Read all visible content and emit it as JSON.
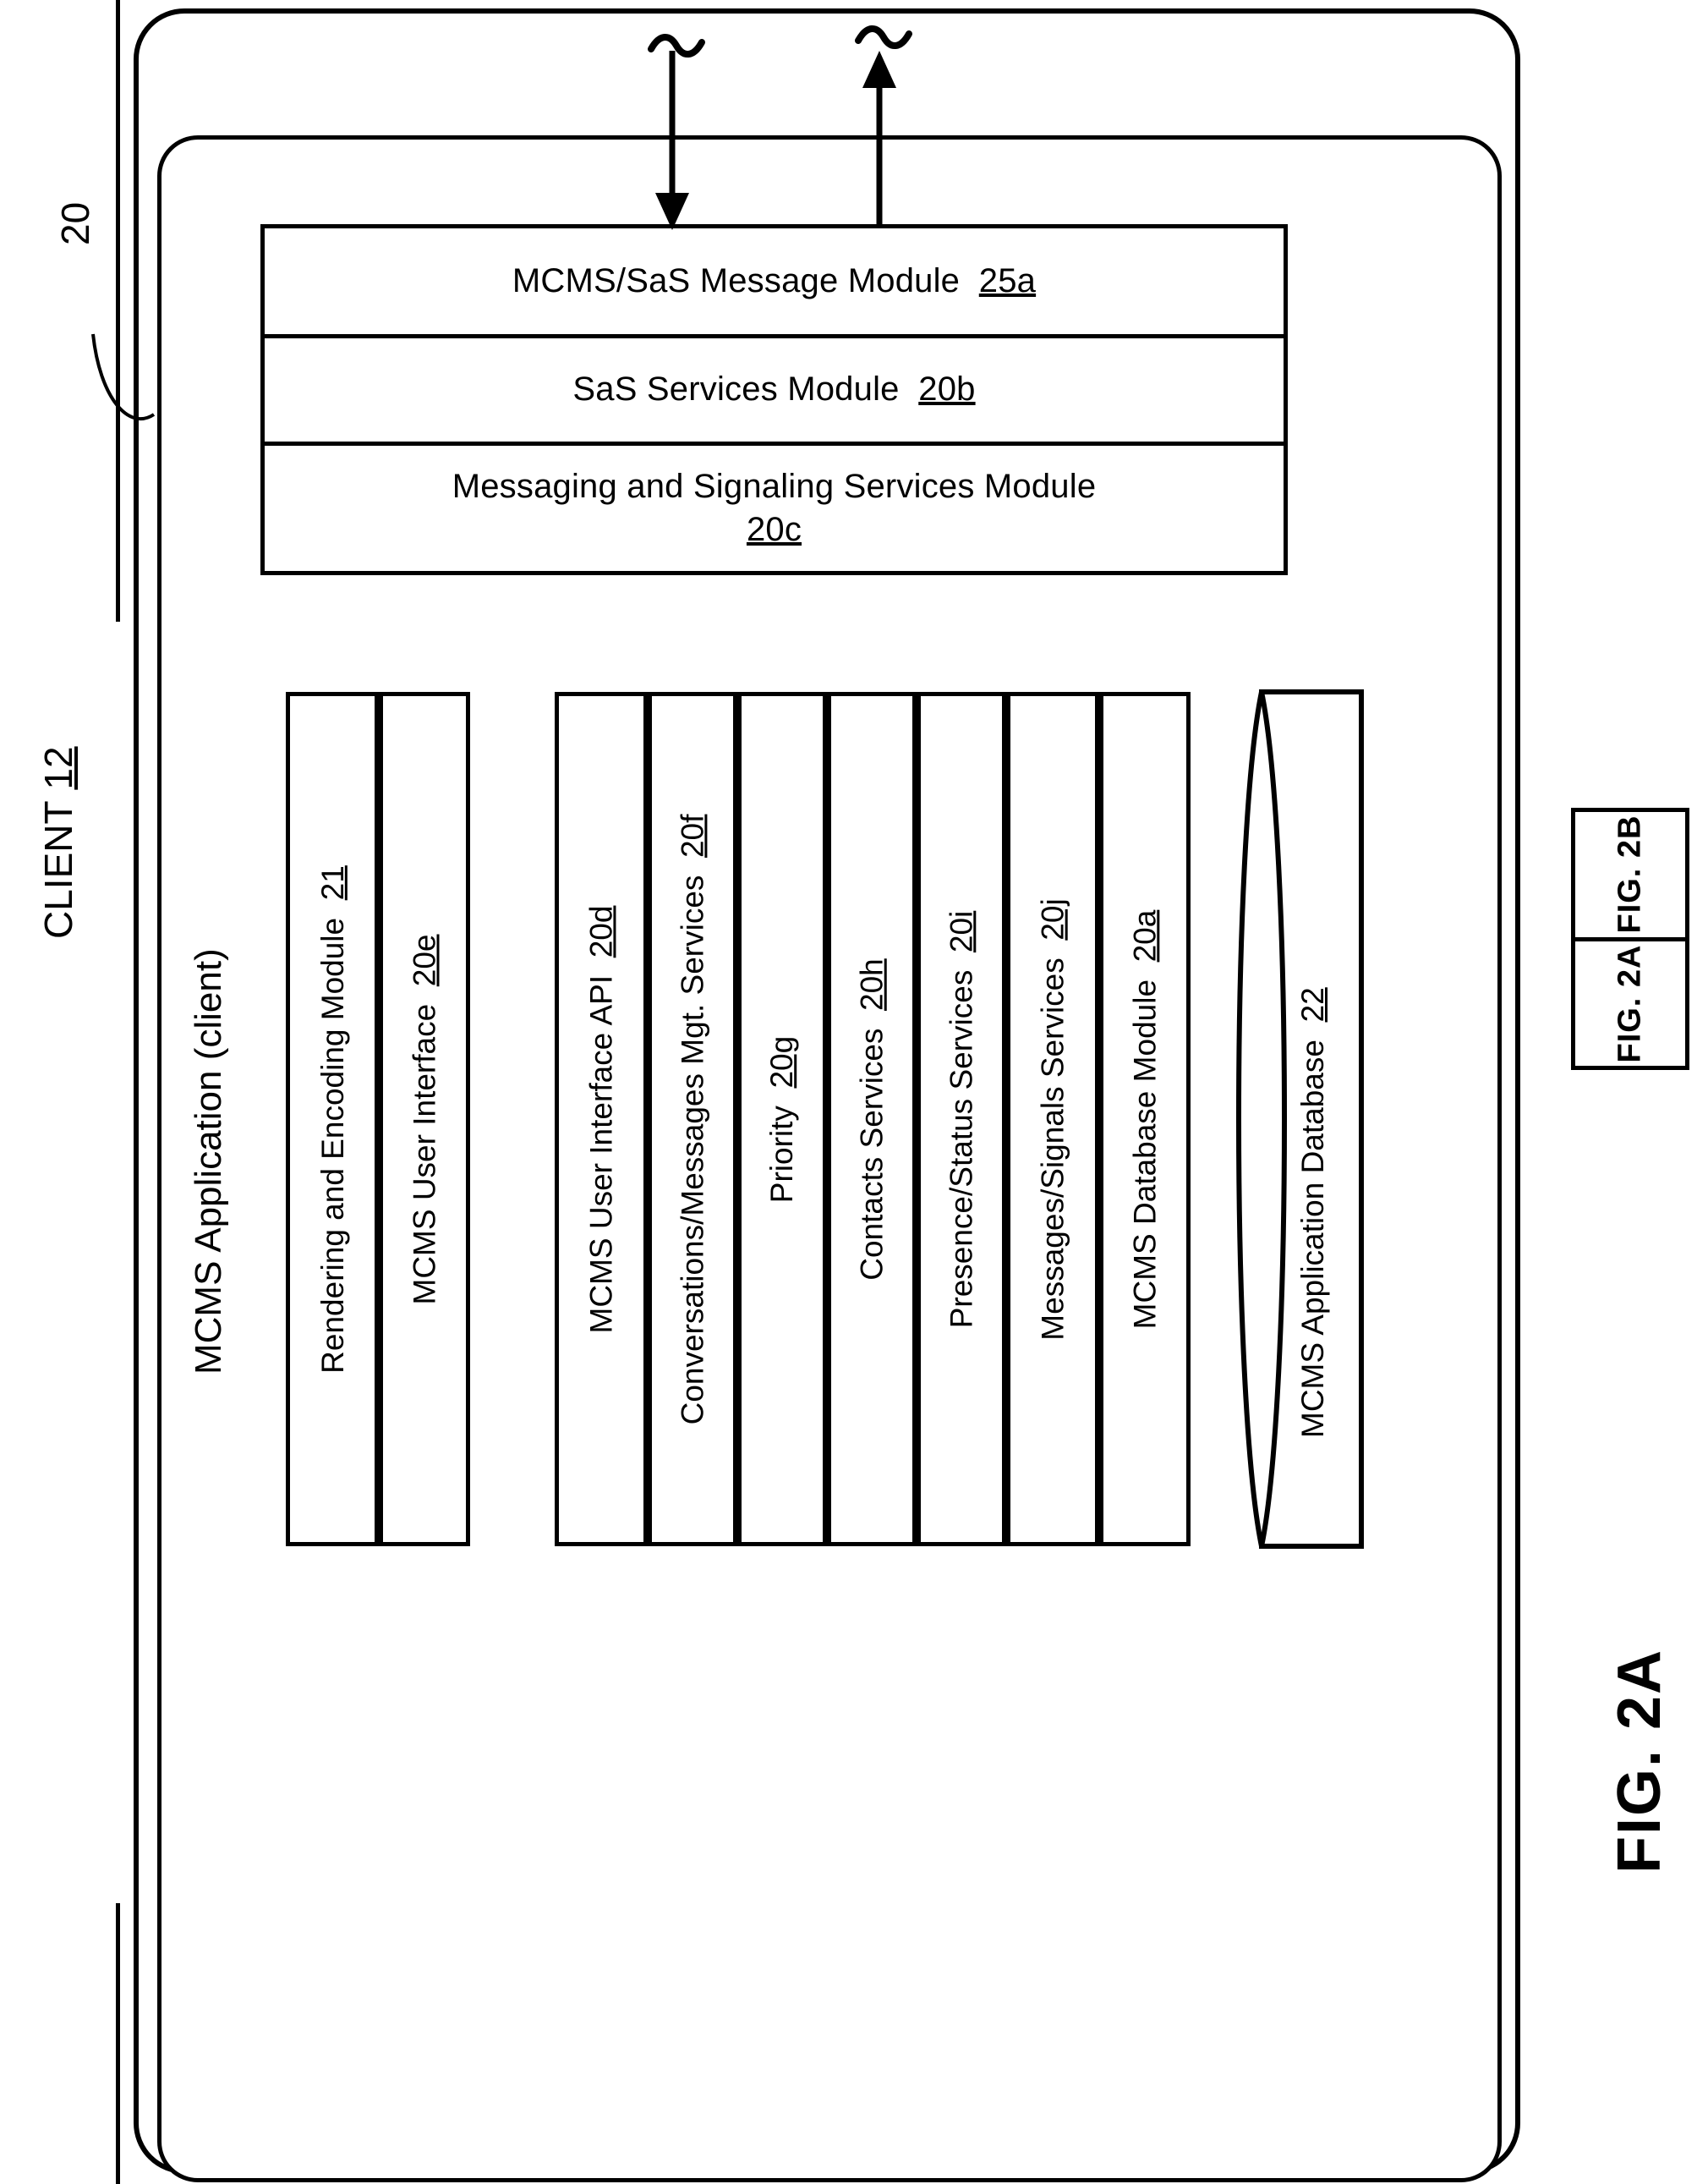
{
  "figure": {
    "title": "FIG. 2A",
    "sheet_reference_number": "20",
    "client_label": "CLIENT",
    "client_refnum": "12",
    "app_label": "MCMS Application (client)",
    "key_box": {
      "cells": [
        "FIG. 2A",
        "FIG. 2B"
      ]
    }
  },
  "top_modules": [
    {
      "label": "MCMS/SaS Message Module",
      "refnum": "25a"
    },
    {
      "label": "SaS Services Module",
      "refnum": "20b"
    },
    {
      "label": "Messaging and Signaling Services Module",
      "refnum": "20c"
    }
  ],
  "group_one": [
    {
      "label": "Rendering and Encoding Module",
      "refnum": "21"
    },
    {
      "label": "MCMS User Interface",
      "refnum": "20e"
    }
  ],
  "group_two": [
    {
      "label": "MCMS User Interface API",
      "refnum": "20d"
    },
    {
      "label": "Conversations/Messages Mgt. Services",
      "refnum": "20f"
    },
    {
      "label": "Priority",
      "refnum": "20g"
    },
    {
      "label": "Contacts Services",
      "refnum": "20h"
    },
    {
      "label": "Presence/Status Services",
      "refnum": "20i"
    },
    {
      "label": "Messages/Signals Services",
      "refnum": "20j"
    }
  ],
  "group_three": [
    {
      "label": "MCMS Database Module",
      "refnum": "20a"
    }
  ],
  "database": {
    "label": "MCMS Application Database",
    "refnum": "22"
  },
  "connectors": [
    {
      "name": "inbound-arrow",
      "direction": "down",
      "break_mark": "tilde"
    },
    {
      "name": "outbound-arrow",
      "direction": "up",
      "break_mark": "tilde"
    }
  ],
  "colors": {
    "ink": "#000000",
    "paper": "#ffffff"
  }
}
